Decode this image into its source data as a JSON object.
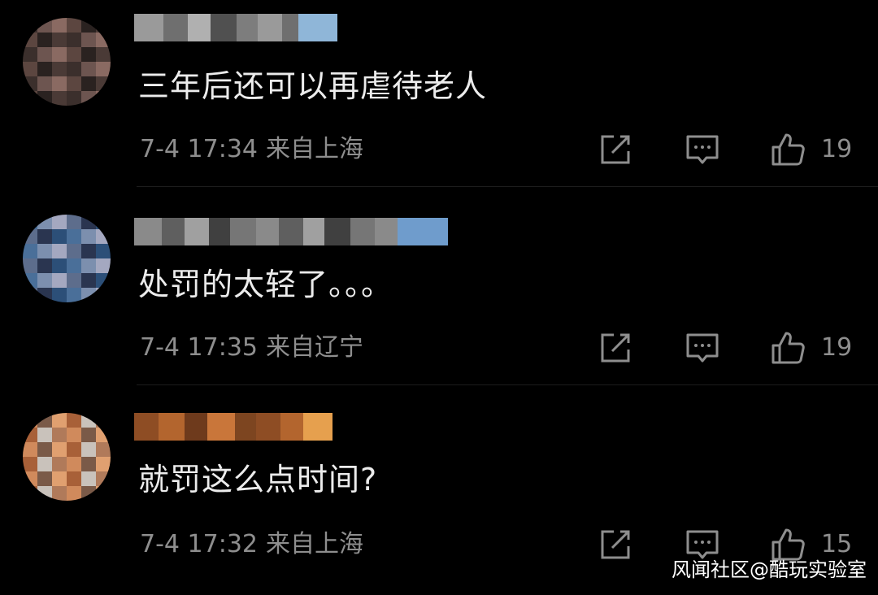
{
  "comments": [
    {
      "text": "三年后还可以再虐待老人",
      "time": "7-4 17:34",
      "location": "来自上海",
      "likes": "19",
      "avatar_colors": [
        "#3b2f2c",
        "#6d5550",
        "#8a6a62",
        "#5c4640",
        "#2a2220",
        "#4a3a36"
      ],
      "name_colors": [
        "#9a9a9a",
        "#6f6f6f",
        "#b0b0b0",
        "#505050",
        "#7d7d7d",
        "#8fb6d8"
      ]
    },
    {
      "text": "处罚的太轻了。。。",
      "time": "7-4 17:35",
      "location": "来自辽宁",
      "likes": "19",
      "avatar_colors": [
        "#2c4f78",
        "#4a6f99",
        "#7c8fae",
        "#a4a8c0",
        "#5d6d8c",
        "#2a3550"
      ],
      "name_colors": [
        "#8a8a8a",
        "#5f5f5f",
        "#a0a0a0",
        "#404040",
        "#767676",
        "#6f9ccc"
      ]
    },
    {
      "text": "就罚这么点时间?",
      "time": "7-4 17:32",
      "location": "来自上海",
      "likes": "15",
      "avatar_colors": [
        "#c9c2bb",
        "#b07a5a",
        "#d08a5c",
        "#7a5a48",
        "#e0a070",
        "#a86038"
      ],
      "name_colors": [
        "#8e4d24",
        "#b3652e",
        "#6e3a1c",
        "#c9763a",
        "#7d4520",
        "#e6a04e"
      ]
    }
  ],
  "icons": {
    "share": "share-icon",
    "reply": "reply-icon",
    "like": "thumbs-up-icon"
  },
  "watermark": "风闻社区@酷玩实验室",
  "colors": {
    "background": "#000000",
    "text": "#ececec",
    "meta": "#8e8e8e"
  }
}
